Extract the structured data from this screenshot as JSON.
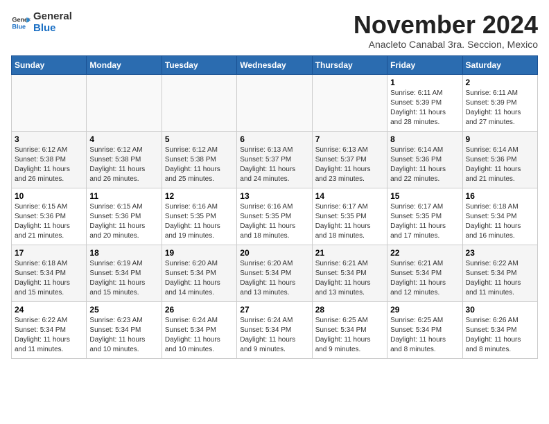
{
  "header": {
    "logo_line1": "General",
    "logo_line2": "Blue",
    "month_title": "November 2024",
    "subtitle": "Anacleto Canabal 3ra. Seccion, Mexico"
  },
  "weekdays": [
    "Sunday",
    "Monday",
    "Tuesday",
    "Wednesday",
    "Thursday",
    "Friday",
    "Saturday"
  ],
  "weeks": [
    [
      {
        "day": "",
        "info": ""
      },
      {
        "day": "",
        "info": ""
      },
      {
        "day": "",
        "info": ""
      },
      {
        "day": "",
        "info": ""
      },
      {
        "day": "",
        "info": ""
      },
      {
        "day": "1",
        "info": "Sunrise: 6:11 AM\nSunset: 5:39 PM\nDaylight: 11 hours\nand 28 minutes."
      },
      {
        "day": "2",
        "info": "Sunrise: 6:11 AM\nSunset: 5:39 PM\nDaylight: 11 hours\nand 27 minutes."
      }
    ],
    [
      {
        "day": "3",
        "info": "Sunrise: 6:12 AM\nSunset: 5:38 PM\nDaylight: 11 hours\nand 26 minutes."
      },
      {
        "day": "4",
        "info": "Sunrise: 6:12 AM\nSunset: 5:38 PM\nDaylight: 11 hours\nand 26 minutes."
      },
      {
        "day": "5",
        "info": "Sunrise: 6:12 AM\nSunset: 5:38 PM\nDaylight: 11 hours\nand 25 minutes."
      },
      {
        "day": "6",
        "info": "Sunrise: 6:13 AM\nSunset: 5:37 PM\nDaylight: 11 hours\nand 24 minutes."
      },
      {
        "day": "7",
        "info": "Sunrise: 6:13 AM\nSunset: 5:37 PM\nDaylight: 11 hours\nand 23 minutes."
      },
      {
        "day": "8",
        "info": "Sunrise: 6:14 AM\nSunset: 5:36 PM\nDaylight: 11 hours\nand 22 minutes."
      },
      {
        "day": "9",
        "info": "Sunrise: 6:14 AM\nSunset: 5:36 PM\nDaylight: 11 hours\nand 21 minutes."
      }
    ],
    [
      {
        "day": "10",
        "info": "Sunrise: 6:15 AM\nSunset: 5:36 PM\nDaylight: 11 hours\nand 21 minutes."
      },
      {
        "day": "11",
        "info": "Sunrise: 6:15 AM\nSunset: 5:36 PM\nDaylight: 11 hours\nand 20 minutes."
      },
      {
        "day": "12",
        "info": "Sunrise: 6:16 AM\nSunset: 5:35 PM\nDaylight: 11 hours\nand 19 minutes."
      },
      {
        "day": "13",
        "info": "Sunrise: 6:16 AM\nSunset: 5:35 PM\nDaylight: 11 hours\nand 18 minutes."
      },
      {
        "day": "14",
        "info": "Sunrise: 6:17 AM\nSunset: 5:35 PM\nDaylight: 11 hours\nand 18 minutes."
      },
      {
        "day": "15",
        "info": "Sunrise: 6:17 AM\nSunset: 5:35 PM\nDaylight: 11 hours\nand 17 minutes."
      },
      {
        "day": "16",
        "info": "Sunrise: 6:18 AM\nSunset: 5:34 PM\nDaylight: 11 hours\nand 16 minutes."
      }
    ],
    [
      {
        "day": "17",
        "info": "Sunrise: 6:18 AM\nSunset: 5:34 PM\nDaylight: 11 hours\nand 15 minutes."
      },
      {
        "day": "18",
        "info": "Sunrise: 6:19 AM\nSunset: 5:34 PM\nDaylight: 11 hours\nand 15 minutes."
      },
      {
        "day": "19",
        "info": "Sunrise: 6:20 AM\nSunset: 5:34 PM\nDaylight: 11 hours\nand 14 minutes."
      },
      {
        "day": "20",
        "info": "Sunrise: 6:20 AM\nSunset: 5:34 PM\nDaylight: 11 hours\nand 13 minutes."
      },
      {
        "day": "21",
        "info": "Sunrise: 6:21 AM\nSunset: 5:34 PM\nDaylight: 11 hours\nand 13 minutes."
      },
      {
        "day": "22",
        "info": "Sunrise: 6:21 AM\nSunset: 5:34 PM\nDaylight: 11 hours\nand 12 minutes."
      },
      {
        "day": "23",
        "info": "Sunrise: 6:22 AM\nSunset: 5:34 PM\nDaylight: 11 hours\nand 11 minutes."
      }
    ],
    [
      {
        "day": "24",
        "info": "Sunrise: 6:22 AM\nSunset: 5:34 PM\nDaylight: 11 hours\nand 11 minutes."
      },
      {
        "day": "25",
        "info": "Sunrise: 6:23 AM\nSunset: 5:34 PM\nDaylight: 11 hours\nand 10 minutes."
      },
      {
        "day": "26",
        "info": "Sunrise: 6:24 AM\nSunset: 5:34 PM\nDaylight: 11 hours\nand 10 minutes."
      },
      {
        "day": "27",
        "info": "Sunrise: 6:24 AM\nSunset: 5:34 PM\nDaylight: 11 hours\nand 9 minutes."
      },
      {
        "day": "28",
        "info": "Sunrise: 6:25 AM\nSunset: 5:34 PM\nDaylight: 11 hours\nand 9 minutes."
      },
      {
        "day": "29",
        "info": "Sunrise: 6:25 AM\nSunset: 5:34 PM\nDaylight: 11 hours\nand 8 minutes."
      },
      {
        "day": "30",
        "info": "Sunrise: 6:26 AM\nSunset: 5:34 PM\nDaylight: 11 hours\nand 8 minutes."
      }
    ]
  ]
}
